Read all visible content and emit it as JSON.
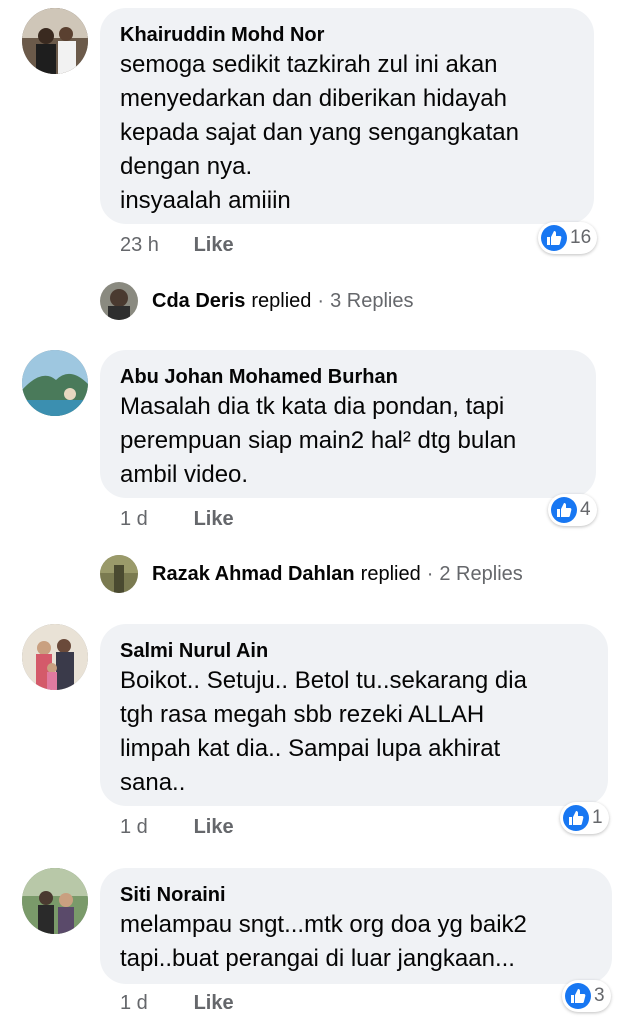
{
  "comments": [
    {
      "name": "Khairuddin Mohd Nor",
      "text": "semoga sedikit tazkirah zul ini akan\nmenyedarkan dan diberikan hidayah\nkepada sajat dan yang sengangkatan\ndengan nya.\ninsyaalah amiiin",
      "time": "23 h",
      "like_label": "Like",
      "reactions": "16"
    },
    {
      "name": "Abu Johan Mohamed Burhan",
      "text": "Masalah dia tk kata dia pondan, tapi\nperempuan siap main2 hal² dtg bulan\nambil video.",
      "time": "1 d",
      "like_label": "Like",
      "reactions": "4"
    },
    {
      "name": "Salmi Nurul Ain",
      "text": "Boikot.. Setuju.. Betol tu..sekarang dia\ntgh rasa megah sbb rezeki ALLAH\nlimpah kat dia.. Sampai lupa akhirat\nsana..",
      "time": "1 d",
      "like_label": "Like",
      "reactions": "1"
    },
    {
      "name": "Siti Noraini",
      "text": "melampau sngt...mtk org doa yg baik2\ntapi..buat perangai di luar jangkaan...",
      "time": "1 d",
      "like_label": "Like",
      "reactions": "3"
    }
  ],
  "replies": [
    {
      "name": "Cda Deris",
      "verb": "replied",
      "separator": "·",
      "count": "3 Replies"
    },
    {
      "name": "Razak Ahmad Dahlan",
      "verb": "replied",
      "separator": "·",
      "count": "2 Replies"
    }
  ],
  "icons": {
    "reaction": "like-thumb-icon"
  },
  "colors": {
    "accent": "#1877f2",
    "bubble": "#f0f2f5",
    "muted": "#65676b"
  }
}
